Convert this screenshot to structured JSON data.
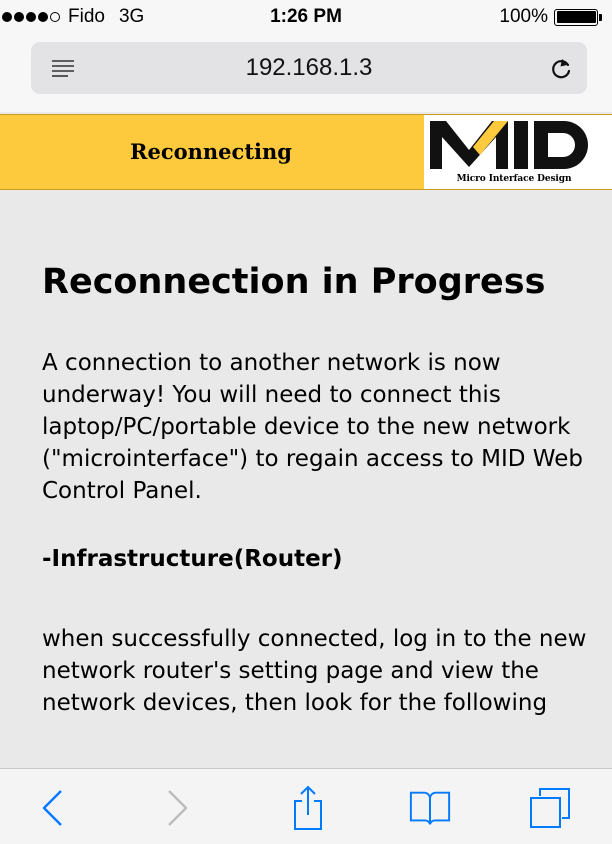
{
  "status_bar": {
    "carrier": "Fido",
    "network": "3G",
    "time": "1:26 PM",
    "battery": "100%",
    "signal_bars_filled": 4,
    "signal_bars_total": 5
  },
  "browser": {
    "url": "192.168.1.3"
  },
  "page_header": {
    "title": "Reconnecting",
    "logo_text": "MID",
    "logo_caption": "Micro Interface Design"
  },
  "content": {
    "heading": "Reconnection in Progress",
    "paragraph": "A connection to another network is now underway! You will need to connect this laptop/PC/portable device to the new network (\"microinterface\") to regain access to MID Web Control Panel.",
    "subheading": "-Infrastructure(Router)",
    "paragraph2": "when successfully connected, log in to the new network router's setting page and view the network devices, then look for the following"
  },
  "toolbar": {
    "back_icon": "chevron-left-icon",
    "forward_icon": "chevron-right-icon",
    "share_icon": "share-icon",
    "bookmarks_icon": "book-icon",
    "tabs_icon": "tabs-icon"
  },
  "colors": {
    "accent_blue": "#007aff",
    "header_yellow": "#fdca3e",
    "page_background": "#e9e9e9"
  }
}
